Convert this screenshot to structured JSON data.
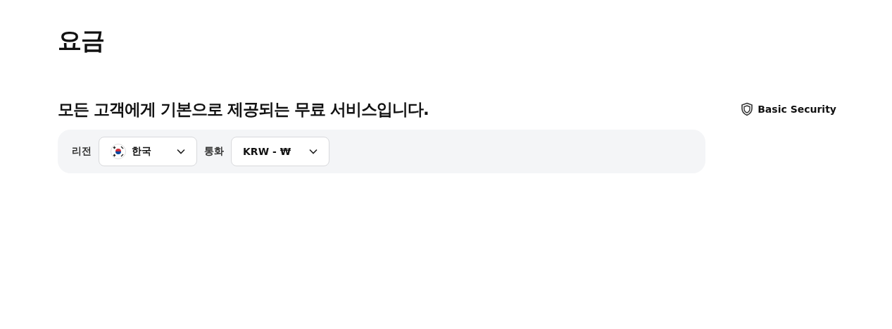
{
  "page_title": "요금",
  "headline": "모든 고객에게 기본으로 제공되는 무료 서비스입니다.",
  "plan": {
    "label": "Basic Security"
  },
  "filters": [
    {
      "label": "리전",
      "value": "한국",
      "kind": "flag"
    },
    {
      "label": "통화",
      "value": "KRW - ₩",
      "kind": "plain"
    }
  ]
}
